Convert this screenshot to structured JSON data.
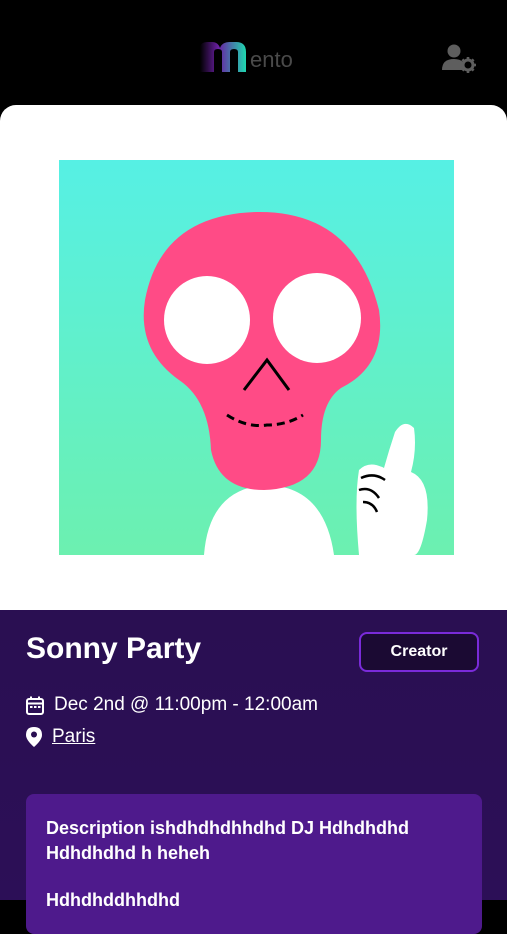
{
  "header": {
    "logo_text": "ento",
    "user_settings_icon": "user-gear-icon"
  },
  "event": {
    "title": "Sonny Party",
    "creator_label": "Creator",
    "datetime": "Dec 2nd @ 11:00pm - 12:00am",
    "location": "Paris",
    "description_line1": "Description ishdhdhdhhdhd DJ Hdhdhdhd Hdhdhdhd h heheh",
    "description_line2": "Hdhdhddhhdhd"
  },
  "colors": {
    "accent": "#7a2bd9",
    "info_bg": "#2a0f52",
    "desc_bg": "#4e1a8c",
    "art_bg": "#56f0dc",
    "skull": "#ff4b86"
  }
}
